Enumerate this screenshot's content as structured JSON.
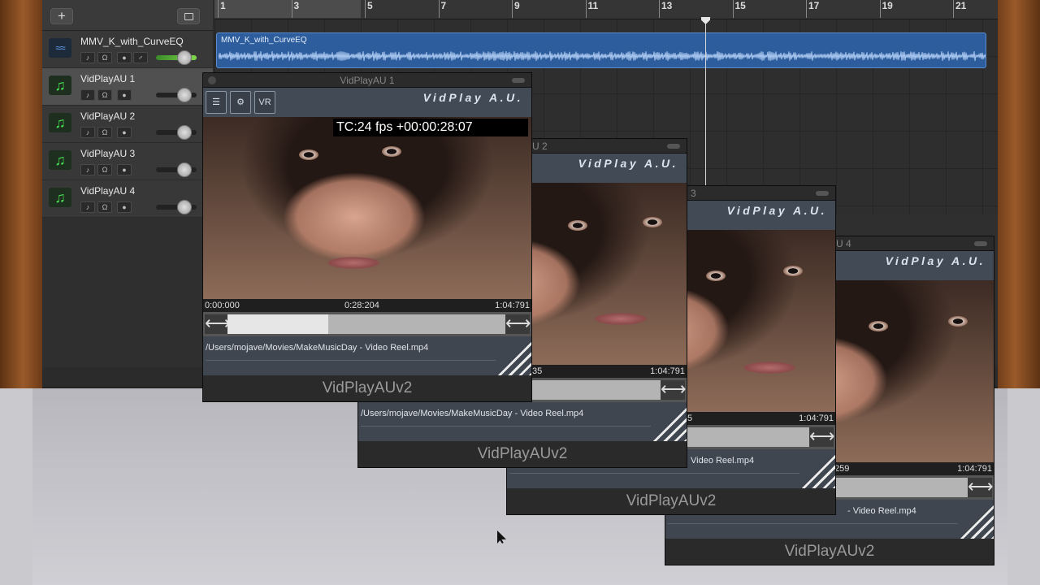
{
  "header": {
    "add_label": "+"
  },
  "ruler": {
    "marks": [
      "1",
      "3",
      "5",
      "7",
      "9",
      "11",
      "13",
      "15",
      "17",
      "19",
      "21"
    ]
  },
  "tracks": [
    {
      "name": "MMV_K_with_CurveEQ",
      "icon": "waveform-icon",
      "kind": "audio",
      "volume": 0.72
    },
    {
      "name": "VidPlayAU 1",
      "icon": "music-note-icon",
      "kind": "instrument",
      "volume": 0.72
    },
    {
      "name": "VidPlayAU 2",
      "icon": "music-note-icon",
      "kind": "instrument",
      "volume": 0.72
    },
    {
      "name": "VidPlayAU 3",
      "icon": "music-note-icon",
      "kind": "instrument",
      "volume": 0.72
    },
    {
      "name": "VidPlayAU 4",
      "icon": "music-note-icon",
      "kind": "instrument",
      "volume": 0.72
    }
  ],
  "region": {
    "name": "MMV_K_with_CurveEQ"
  },
  "plugin_windows": [
    {
      "title": "VidPlayAU 1",
      "brand": "VidPlay A.U.",
      "tools": [
        "document-icon",
        "gear-icon",
        "vr-icon"
      ],
      "tool_vr_label": "VR",
      "timecode": "TC:24 fps +00:00:28:07",
      "time_start": "0:00:000",
      "time_current": "0:28:204",
      "time_end": "1:04:791",
      "progress": 0.36,
      "path": "/Users/mojave/Movies/MakeMusicDay - Video Reel.mp4",
      "footer": "VidPlayAUv2"
    },
    {
      "title_fragment": "U 2",
      "brand": "VidPlay A.U.",
      "time_fragment": "35",
      "time_end": "1:04:791",
      "path": "/Users/mojave/Movies/MakeMusicDay - Video Reel.mp4",
      "footer": "VidPlayAUv2"
    },
    {
      "title_fragment": "3",
      "brand": "VidPlay A.U.",
      "time_fragment": "5",
      "time_end": "1:04:791",
      "path_fragment": "Video Reel.mp4",
      "footer": "VidPlayAUv2"
    },
    {
      "title_fragment": "U 4",
      "brand": "VidPlay A.U.",
      "time_fragment": "259",
      "time_end": "1:04:791",
      "path_fragment": "- Video Reel.mp4",
      "footer": "VidPlayAUv2"
    }
  ],
  "colors": {
    "accent_green": "#47e052",
    "region_blue": "#2d5d9c",
    "plugin_panel": "#414a55"
  }
}
